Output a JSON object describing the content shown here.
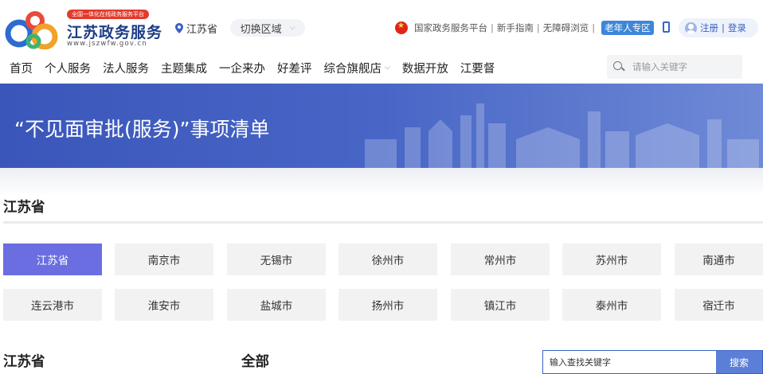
{
  "header": {
    "logo_badge": "全国一体化在线政务服务平台",
    "logo_title": "江苏政务服务",
    "logo_url": "www.jszwfw.gov.cn",
    "location": "江苏省",
    "region_switch": "切换区域",
    "links": {
      "national": "国家政务服务平台",
      "guide": "新手指南",
      "accessible": "无障碍浏览",
      "elder": "老年人专区"
    },
    "register": "注册",
    "login": "登录"
  },
  "nav": {
    "items": [
      "首页",
      "个人服务",
      "法人服务",
      "主题集成",
      "一企来办",
      "好差评",
      "综合旗舰店",
      "数据开放",
      "江要督"
    ],
    "search_placeholder": "请输入关键字"
  },
  "banner": {
    "title": "“不见面审批(服务)”事项清单"
  },
  "province": {
    "title": "江苏省",
    "cities": [
      "江苏省",
      "南京市",
      "无锡市",
      "徐州市",
      "常州市",
      "苏州市",
      "南通市",
      "连云港市",
      "淮安市",
      "盐城市",
      "扬州市",
      "镇江市",
      "泰州市",
      "宿迁市"
    ],
    "active_index": 0
  },
  "list": {
    "area_label": "江苏省",
    "category_label": "全部",
    "search_placeholder": "输入查找关键字",
    "search_button": "搜索"
  },
  "colors": {
    "brand_blue": "#1c3d86",
    "banner_blue": "#4866c6",
    "active_city": "#6a6ee0",
    "elder_blue": "#3e86d8"
  }
}
